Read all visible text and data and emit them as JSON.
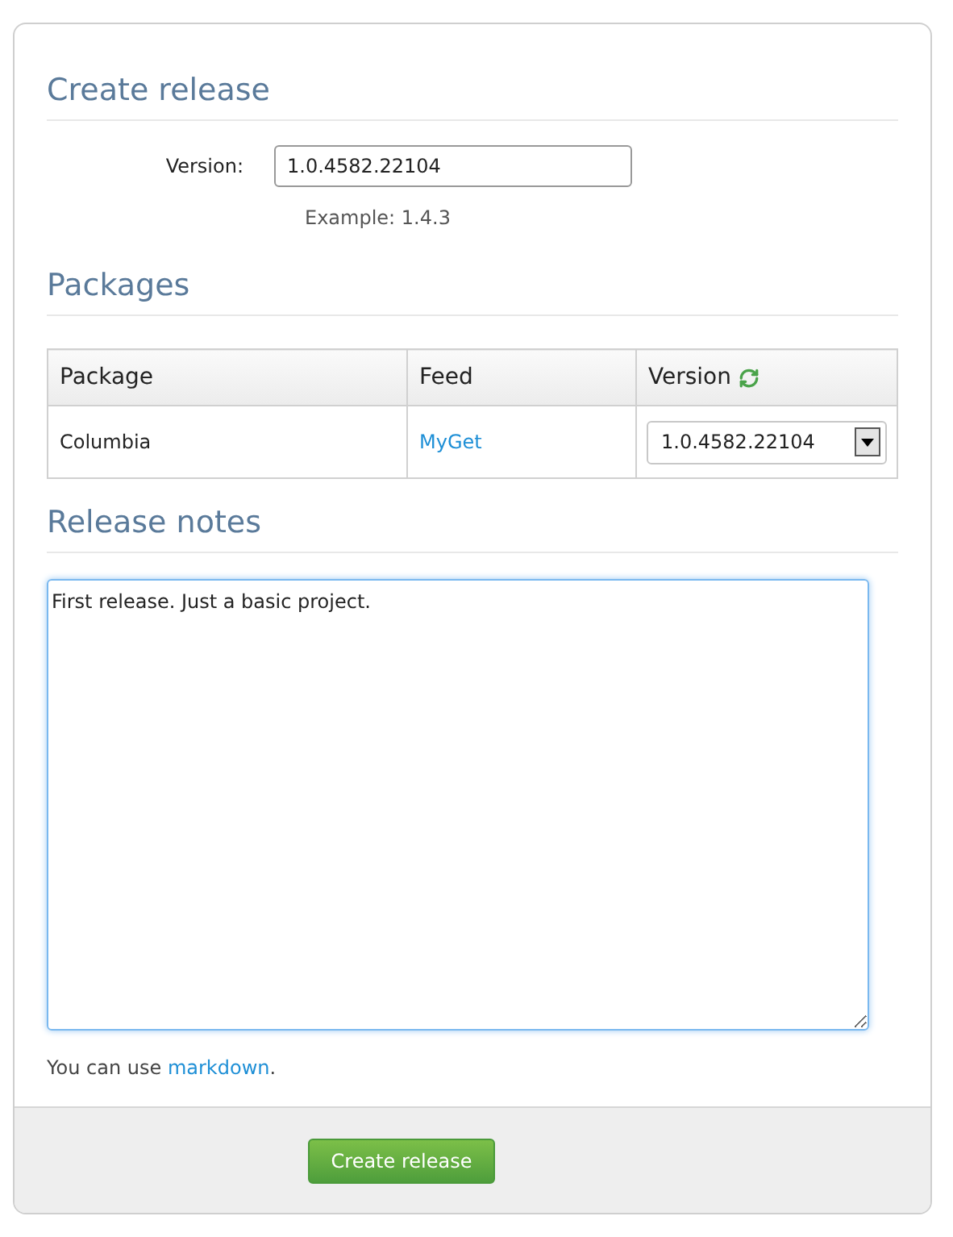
{
  "title": "Create release",
  "version_field": {
    "label": "Version:",
    "value": "1.0.4582.22104",
    "hint": "Example: 1.4.3"
  },
  "packages": {
    "title": "Packages",
    "columns": [
      "Package",
      "Feed",
      "Version"
    ],
    "rows": [
      {
        "package": "Columbia",
        "feed": "MyGet",
        "version": "1.0.4582.22104"
      }
    ]
  },
  "release_notes": {
    "title": "Release notes",
    "value": "First release. Just a basic project.",
    "focused": true,
    "hint": {
      "before": "You can use ",
      "link": "markdown",
      "after": "."
    }
  },
  "submit_button": "Create release"
}
